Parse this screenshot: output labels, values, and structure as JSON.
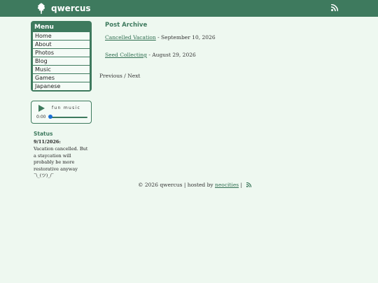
{
  "header": {
    "title": "qwercus",
    "logo_icon": "oak-leaf-icon",
    "rss_icon": "rss-icon"
  },
  "menu": {
    "title": "Menu",
    "items": [
      {
        "label": "Home"
      },
      {
        "label": "About"
      },
      {
        "label": "Photos"
      },
      {
        "label": "Blog"
      },
      {
        "label": "Music"
      },
      {
        "label": "Games"
      },
      {
        "label": "Japanese"
      }
    ]
  },
  "player": {
    "title": "fun music",
    "time": "0:00",
    "progress": 0,
    "play_icon": "play-icon"
  },
  "status": {
    "title": "Status",
    "date": "9/11/2026:",
    "text": "Vacation cancelled. But a staycation will probably be more restorative anyway ¯\\_(ツ)_/¯"
  },
  "archive": {
    "title": "Post Archive",
    "posts": [
      {
        "title": "Cancelled Vacation",
        "date": " - September 10, 2026"
      },
      {
        "title": "Seed Collecting",
        "date": " - August 29, 2026"
      }
    ],
    "previous": "Previous",
    "separator": " / ",
    "next": "Next"
  },
  "footer": {
    "copyright": "© 2026 qwercus | hosted by ",
    "host_link": "neocities",
    "separator": " | "
  },
  "colors": {
    "accent": "#3e7a5e",
    "background": "#eef8f0",
    "link": "#2f6e50"
  }
}
